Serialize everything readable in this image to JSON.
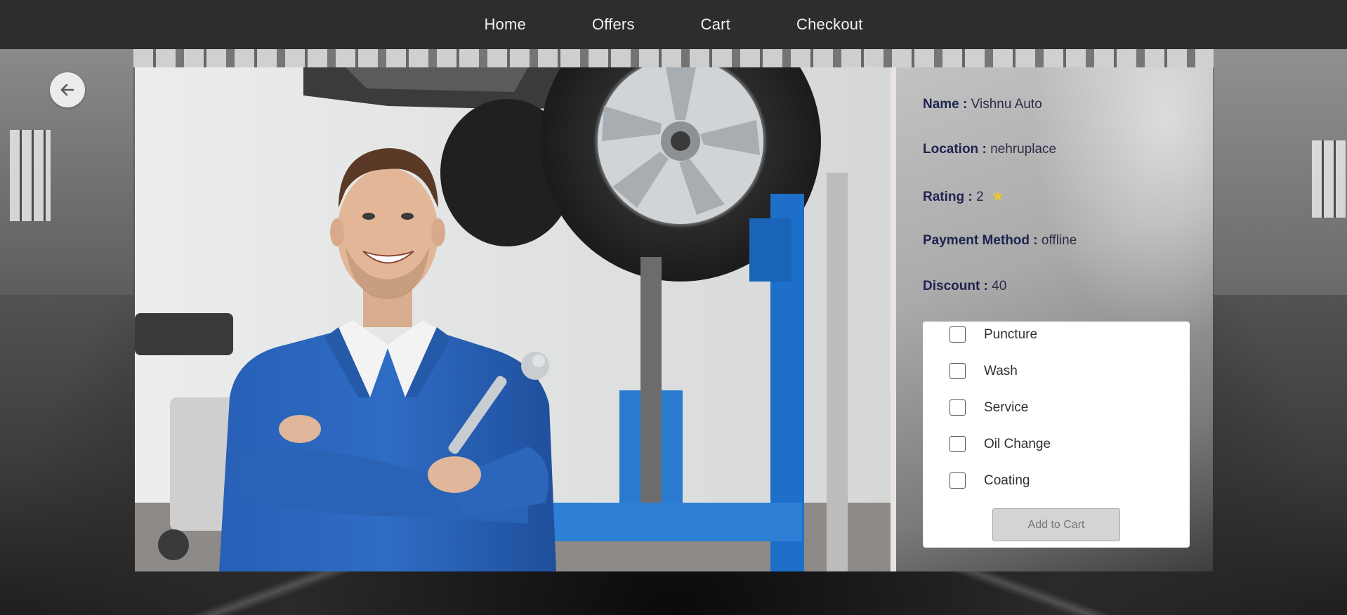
{
  "nav": {
    "items": [
      {
        "label": "Home"
      },
      {
        "label": "Offers"
      },
      {
        "label": "Cart"
      },
      {
        "label": "Checkout"
      }
    ]
  },
  "back_button": {
    "icon": "arrow-left-icon"
  },
  "shop": {
    "name_label": "Name :",
    "name": "Vishnu Auto",
    "location_label": "Location :",
    "location": "nehruplace",
    "rating_label": "Rating :",
    "rating": "2",
    "rating_icon": "star-icon",
    "payment_label": "Payment Method :",
    "payment": "offline",
    "discount_label": "Discount :",
    "discount": "40"
  },
  "services": [
    {
      "label": "Puncture",
      "checked": false
    },
    {
      "label": "Wash",
      "checked": false
    },
    {
      "label": "Service",
      "checked": false
    },
    {
      "label": "Oil Change",
      "checked": false
    },
    {
      "label": "Coating",
      "checked": false
    }
  ],
  "add_to_cart_label": "Add to Cart",
  "colors": {
    "navbar": "#2e2c2c",
    "label": "#1f2350",
    "mechanic_uniform": "#2c64b4",
    "lift": "#1d6fc9",
    "star": "#f3c623"
  }
}
